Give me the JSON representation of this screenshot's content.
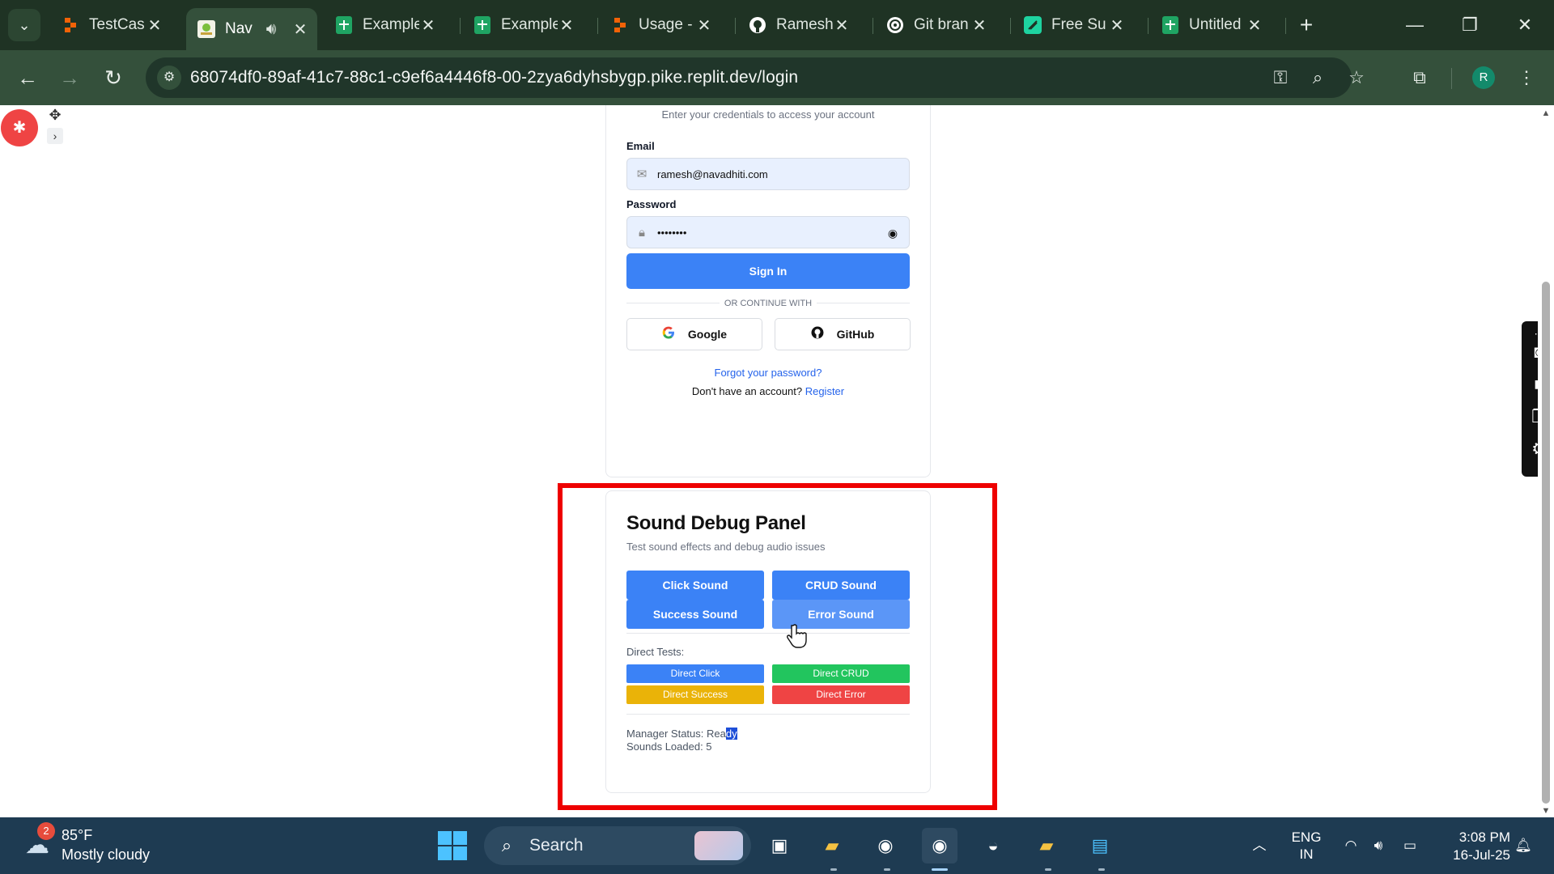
{
  "browser": {
    "tabs": [
      {
        "title": "TestCas",
        "favicon": "replit-icon",
        "color": "#f26207"
      },
      {
        "title": "Nav",
        "favicon": "navadhiti-icon",
        "color": "#7bbf3c",
        "active": true
      },
      {
        "title": "Example",
        "favicon": "sheets-icon",
        "color": "#1fa463"
      },
      {
        "title": "Example",
        "favicon": "sheets-icon",
        "color": "#1fa463"
      },
      {
        "title": "Usage -",
        "favicon": "replit-icon",
        "color": "#f26207"
      },
      {
        "title": "Ramesh",
        "favicon": "github-icon",
        "color": "#ffffff"
      },
      {
        "title": "Git bran",
        "favicon": "openai-icon",
        "color": "#ffffff"
      },
      {
        "title": "Free Su",
        "favicon": "supabase-icon",
        "color": "#1ed3a0"
      },
      {
        "title": "Untitled",
        "favicon": "sheets-icon",
        "color": "#1fa463"
      }
    ],
    "url": "68074df0-89af-41c7-88c1-c9ef6a4446f8-00-2zya6dyhsbygp.pike.replit.dev/login",
    "profile_initial": "R"
  },
  "login": {
    "subtitle": "Enter your credentials to access your account",
    "email_label": "Email",
    "email_value": "ramesh@navadhiti.com",
    "password_label": "Password",
    "password_value": "••••••••",
    "sign_in": "Sign In",
    "divider": "OR CONTINUE WITH",
    "google": "Google",
    "github": "GitHub",
    "forgot": "Forgot your password?",
    "no_account": "Don't have an account?",
    "register": "Register"
  },
  "debug_panel": {
    "title": "Sound Debug Panel",
    "subtitle": "Test sound effects and debug audio issues",
    "buttons": [
      "Click Sound",
      "CRUD Sound",
      "Success Sound",
      "Error Sound"
    ],
    "direct_label": "Direct Tests:",
    "direct_buttons": [
      {
        "label": "Direct Click",
        "color": "#3b82f6"
      },
      {
        "label": "Direct CRUD",
        "color": "#22c55e"
      },
      {
        "label": "Direct Success",
        "color": "#eab308"
      },
      {
        "label": "Direct Error",
        "color": "#ef4444"
      }
    ],
    "status_prefix": "Manager Status: ",
    "status_value_plain": "Rea",
    "status_value_selected": "dy",
    "sounds_loaded": "Sounds Loaded: 5"
  },
  "taskbar": {
    "weather_badge": "2",
    "weather_temp": "85°F",
    "weather_desc": "Mostly cloudy",
    "search_placeholder": "Search",
    "lang_line1": "ENG",
    "lang_line2": "IN",
    "time": "3:08 PM",
    "date": "16-Jul-25"
  }
}
